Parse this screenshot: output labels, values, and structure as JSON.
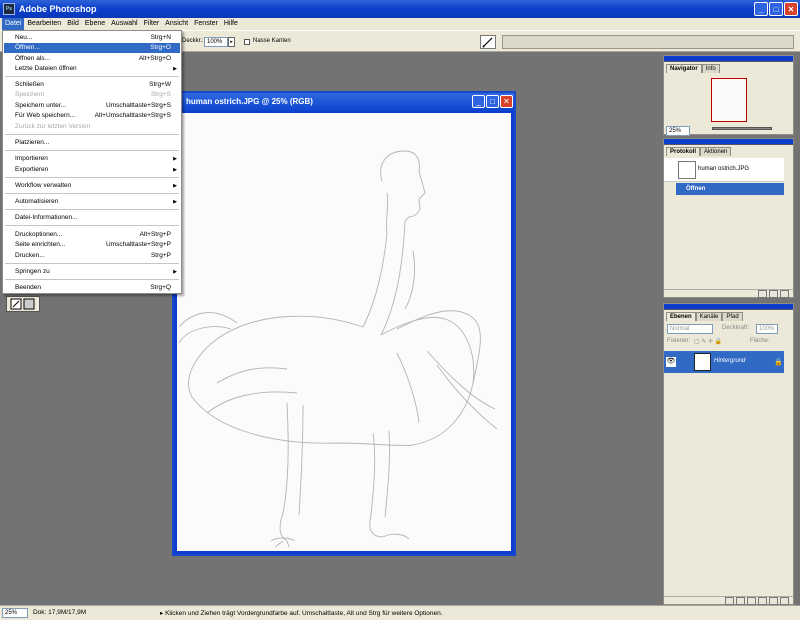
{
  "app": {
    "title": "Adobe Photoshop",
    "icon_text": "Ps"
  },
  "window_buttons": {
    "minimize": "_",
    "maximize": "□",
    "close": "✕"
  },
  "menubar": [
    "Datei",
    "Bearbeiten",
    "Bild",
    "Ebene",
    "Auswahl",
    "Filter",
    "Ansicht",
    "Fenster",
    "Hilfe"
  ],
  "options": {
    "opacity_label": "Deckkr.:",
    "opacity_value": "100%",
    "wet_edges": "Nasse Kanten"
  },
  "file_menu": [
    {
      "label": "Neu...",
      "shortcut": "Strg+N"
    },
    {
      "label": "Öffnen...",
      "shortcut": "Strg+O"
    },
    {
      "label": "Öffnen als...",
      "shortcut": "Alt+Strg+O"
    },
    {
      "label": "Letzte Dateien öffnen",
      "submenu": "▶"
    },
    {
      "label": "Schließen",
      "shortcut": "Strg+W"
    },
    {
      "label": "Speichern",
      "shortcut": "Strg+S"
    },
    {
      "label": "Speichern unter...",
      "shortcut": "Umschalttaste+Strg+S"
    },
    {
      "label": "Für Web speichern...",
      "shortcut": "Alt+Umschalttaste+Strg+S"
    },
    {
      "label": "Zurück zur letzten Version"
    },
    {
      "label": "Platzieren..."
    },
    {
      "label": "Importieren",
      "submenu": "▶"
    },
    {
      "label": "Exportieren",
      "submenu": "▶"
    },
    {
      "label": "Workflow verwalten",
      "submenu": "▶"
    },
    {
      "label": "Automatisieren",
      "submenu": "▶"
    },
    {
      "label": "Datei-Informationen..."
    },
    {
      "label": "Druckoptionen...",
      "shortcut": "Alt+Strg+P"
    },
    {
      "label": "Seite einrichten...",
      "shortcut": "Umschalttaste+Strg+P"
    },
    {
      "label": "Drucken...",
      "shortcut": "Strg+P"
    },
    {
      "label": "Springen zu",
      "submenu": "▶"
    },
    {
      "label": "Beenden",
      "shortcut": "Strg+Q"
    }
  ],
  "document": {
    "title": "human ostrich.JPG @ 25% (RGB)"
  },
  "navigator": {
    "tab_active": "Navigator",
    "tab_other": "Info",
    "zoom": "25%"
  },
  "history": {
    "tab_active": "Protokoll",
    "tab_other": "Aktionen",
    "snapshot": "human ostrich.JPG",
    "step": "Öffnen"
  },
  "layers": {
    "tabs": [
      "Ebenen",
      "Kanäle",
      "Pfad"
    ],
    "blend_mode": "Normal",
    "opacity_label": "Deckkraft:",
    "opacity_value": "100%",
    "lock_label": "Fixieren:",
    "fill_label": "Fläche:",
    "layer_name": "Hintergrund"
  },
  "status": {
    "zoom": "25%",
    "doc_info": "Dok: 17,9M/17,9M",
    "hint": "Klicken und Ziehen trägt Vordergrundfarbe auf. Umschalttaste, Alt und Strg für weitere Optionen."
  }
}
